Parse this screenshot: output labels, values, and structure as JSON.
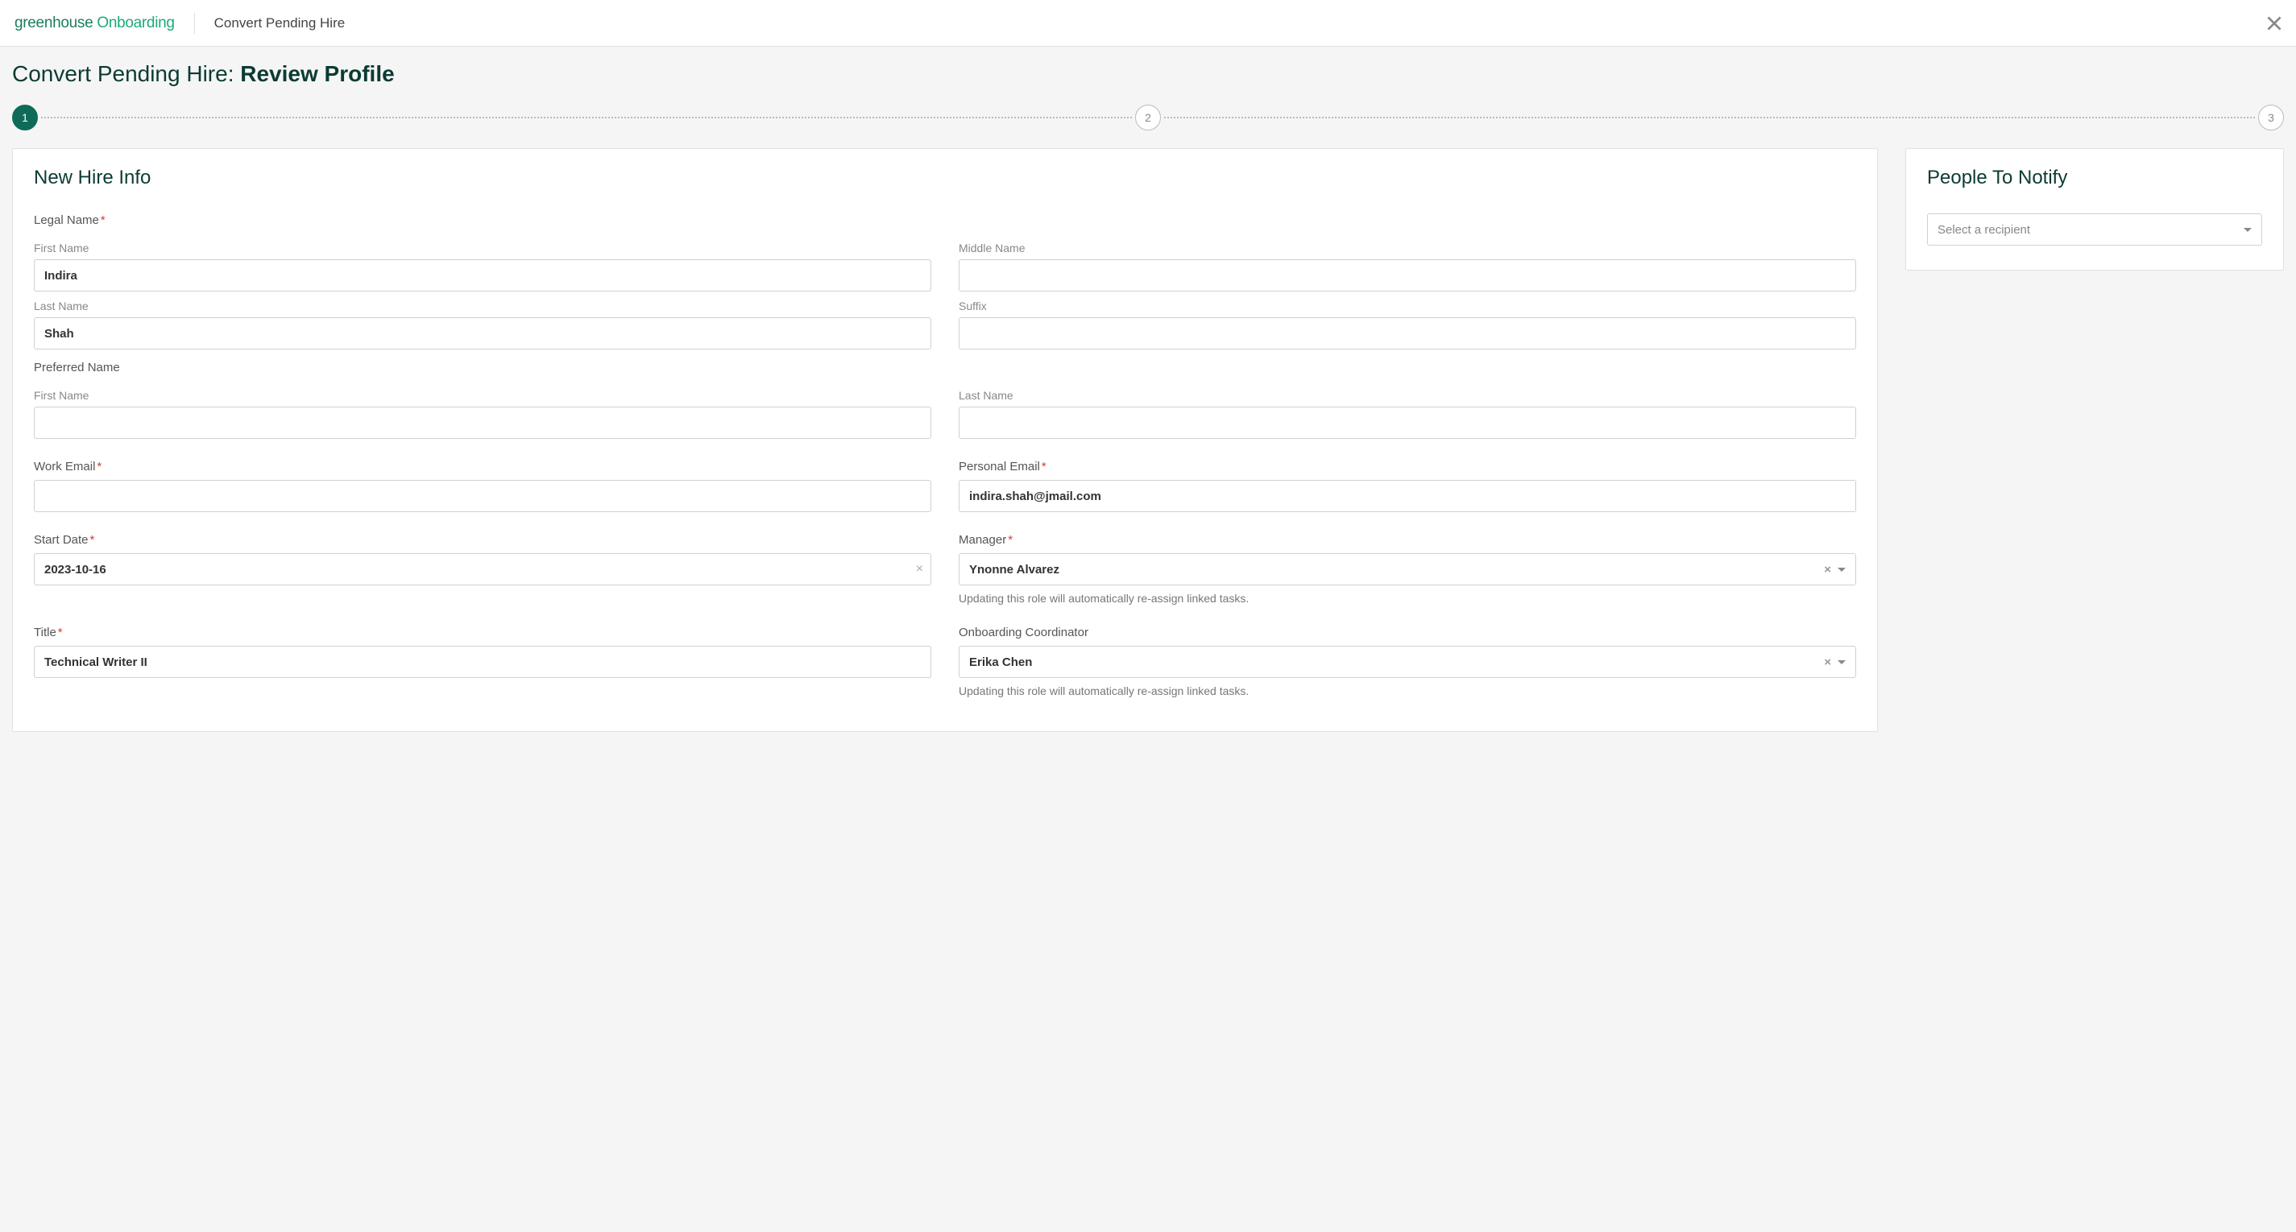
{
  "header": {
    "logo_part1": "greenhouse",
    "logo_part2": "Onboarding",
    "title": "Convert Pending Hire"
  },
  "page": {
    "title_prefix": "Convert Pending Hire: ",
    "title_bold": "Review Profile"
  },
  "stepper": {
    "steps": [
      "1",
      "2",
      "3"
    ],
    "current": 1
  },
  "left_card": {
    "heading": "New Hire Info",
    "legal_name": {
      "label": "Legal Name",
      "first_label": "First Name",
      "first_value": "Indira",
      "middle_label": "Middle Name",
      "middle_value": "",
      "last_label": "Last Name",
      "last_value": "Shah",
      "suffix_label": "Suffix",
      "suffix_value": ""
    },
    "preferred_name": {
      "label": "Preferred Name",
      "first_label": "First Name",
      "first_value": "",
      "last_label": "Last Name",
      "last_value": ""
    },
    "work_email": {
      "label": "Work Email",
      "value": ""
    },
    "personal_email": {
      "label": "Personal Email",
      "value": "indira.shah@jmail.com"
    },
    "start_date": {
      "label": "Start Date",
      "value": "2023-10-16"
    },
    "manager": {
      "label": "Manager",
      "value": "Ynonne Alvarez",
      "helper": "Updating this role will automatically re-assign linked tasks."
    },
    "title": {
      "label": "Title",
      "value": "Technical Writer II"
    },
    "coordinator": {
      "label": "Onboarding Coordinator",
      "value": "Erika Chen",
      "helper": "Updating this role will automatically re-assign linked tasks."
    }
  },
  "right_card": {
    "heading": "People To Notify",
    "placeholder": "Select a recipient"
  }
}
